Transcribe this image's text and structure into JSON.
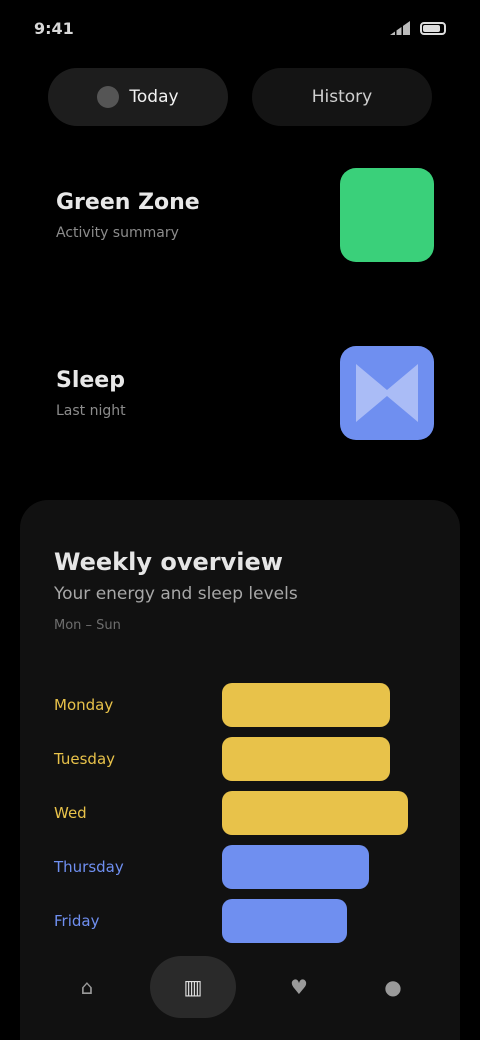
{
  "status": {
    "time": "9:41"
  },
  "tabs": [
    {
      "label": "Today",
      "active": true,
      "icon": "calendar-icon"
    },
    {
      "label": "History",
      "active": false,
      "icon": "clock-icon"
    }
  ],
  "stats": [
    {
      "label": "Green Zone",
      "sub": "Activity summary",
      "note": "",
      "color": "#3ad07a",
      "icon": "square-tile"
    },
    {
      "label": "Sleep",
      "sub": "Last night",
      "note": "",
      "color": "#6f8ff0",
      "icon": "bowtie-icon"
    }
  ],
  "panel": {
    "title": "Weekly overview",
    "subtitle": "Your energy and sleep levels",
    "caption": "Mon – Sun"
  },
  "bars": [
    {
      "label": "Monday",
      "fraction": 0.78,
      "color": "#e8c24a"
    },
    {
      "label": "Tuesday",
      "fraction": 0.78,
      "color": "#e8c24a"
    },
    {
      "label": "Wed",
      "fraction": 0.86,
      "color": "#e8c24a"
    },
    {
      "label": "Thursday",
      "fraction": 0.68,
      "color": "#6f8ff0"
    },
    {
      "label": "Friday",
      "fraction": 0.58,
      "color": "#6f8ff0"
    }
  ],
  "nav": [
    {
      "name": "home-icon",
      "glyph": "⌂",
      "active": false
    },
    {
      "name": "stats-icon",
      "glyph": "▥",
      "active": true
    },
    {
      "name": "pulse-icon",
      "glyph": "♥",
      "active": false
    },
    {
      "name": "profile-icon",
      "glyph": "●",
      "active": false
    }
  ]
}
